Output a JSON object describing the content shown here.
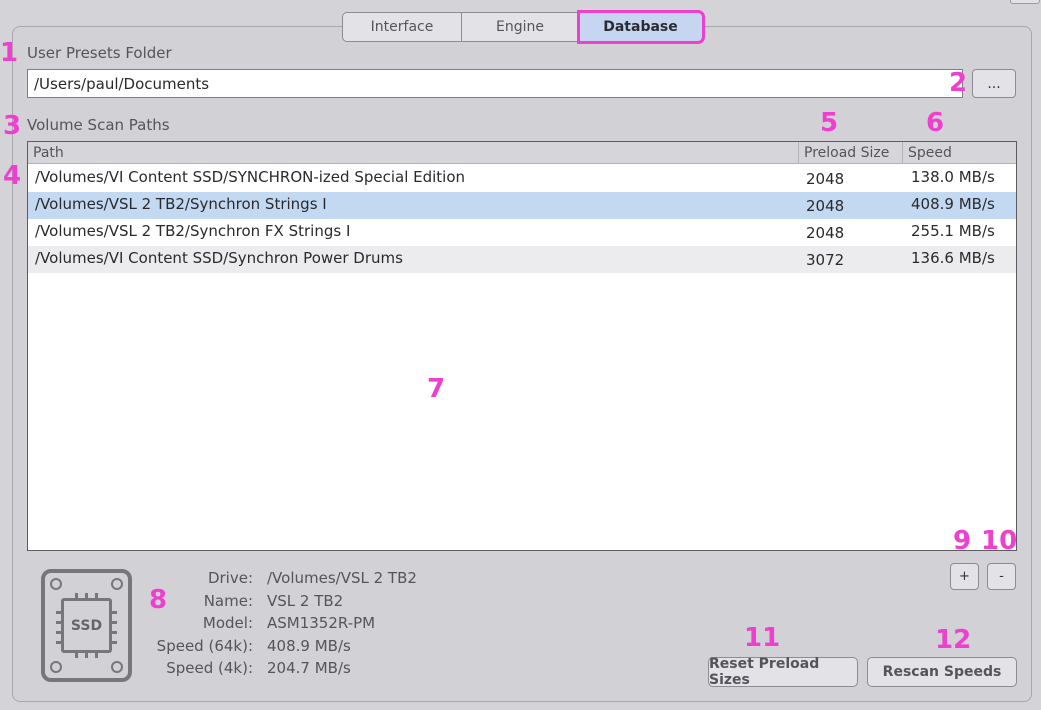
{
  "tabs": [
    {
      "label": "Interface"
    },
    {
      "label": "Engine"
    },
    {
      "label": "Database"
    }
  ],
  "user_presets": {
    "label": "User Presets Folder",
    "value": "/Users/paul/Documents",
    "browse_label": "..."
  },
  "volume_scan": {
    "label": "Volume Scan Paths",
    "columns": [
      "Path",
      "Preload Size",
      "Speed"
    ],
    "rows": [
      {
        "path": "/Volumes/VI Content SSD/SYNCHRON-ized Special Edition",
        "preload": "2048",
        "speed": "138.0 MB/s"
      },
      {
        "path": "/Volumes/VSL 2 TB2/Synchron Strings I",
        "preload": "2048",
        "speed": "408.9 MB/s"
      },
      {
        "path": "/Volumes/VSL 2 TB2/Synchron FX Strings I",
        "preload": "2048",
        "speed": "255.1 MB/s"
      },
      {
        "path": "/Volumes/VI Content SSD/Synchron Power Drums",
        "preload": "3072",
        "speed": "136.6 MB/s"
      }
    ],
    "selected_row": 1
  },
  "drive_info": {
    "icon_label": "SSD",
    "fields": [
      {
        "key": "Drive:",
        "value": "/Volumes/VSL 2 TB2"
      },
      {
        "key": "Name:",
        "value": "VSL 2 TB2"
      },
      {
        "key": "Model:",
        "value": "ASM1352R-PM"
      },
      {
        "key": "Speed (64k):",
        "value": "408.9 MB/s"
      },
      {
        "key": "Speed (4k):",
        "value": "204.7 MB/s"
      }
    ]
  },
  "buttons": {
    "add": "+",
    "remove": "-",
    "reset_preload": "Reset Preload Sizes",
    "rescan": "Rescan Speeds"
  },
  "annotations": [
    "1",
    "2",
    "3",
    "4",
    "5",
    "6",
    "7",
    "8",
    "9",
    "10",
    "11",
    "12"
  ],
  "colors": {
    "highlight": "#ee3fce",
    "selected_row": "#c3d9f1",
    "active_tab": "#c6d6f1"
  }
}
